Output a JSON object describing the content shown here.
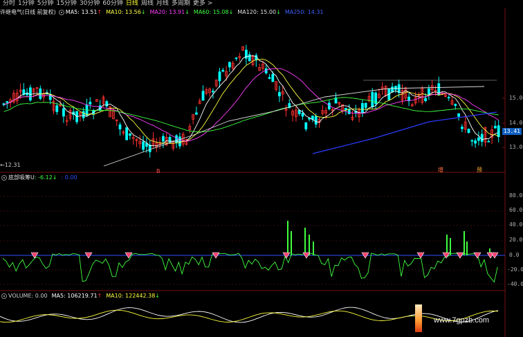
{
  "toolbar": {
    "items": [
      "分时",
      "1分钟",
      "5分钟",
      "15分钟",
      "30分钟",
      "60分钟",
      "日线",
      "周线",
      "月线",
      "多周期",
      "更多"
    ],
    "active_index": 6,
    "more_arrow": ">"
  },
  "main_pane": {
    "title": "许继电气(日线 前复权)",
    "ma": [
      {
        "label": "MA5: 13.51",
        "arrow": "↑",
        "color": "#ffffff"
      },
      {
        "label": "MA10: 13.56",
        "arrow": "↓",
        "color": "#ffff40"
      },
      {
        "label": "MA20: 13.91",
        "arrow": "↓",
        "color": "#ff40ff"
      },
      {
        "label": "MA60: 15.08",
        "arrow": "↓",
        "color": "#40ff40"
      },
      {
        "label": "MA120: 15.00",
        "arrow": "↓",
        "color": "#e0e0e0"
      },
      {
        "label": "MA250: 14.31",
        "arrow": "",
        "color": "#4060ff"
      }
    ],
    "axis": [
      "15.0",
      "14.0",
      "13.0"
    ],
    "last_price": "13.41",
    "min_label": "12.31",
    "signals": [
      "B",
      "增",
      "预"
    ]
  },
  "indicator_pane": {
    "title": "底部吸筹U",
    "values": [
      {
        "label": ": -6.12",
        "arrow": "↓",
        "color": "#40ff40"
      },
      {
        "label": ": 0.00",
        "arrow": "",
        "color": "#3050ff"
      }
    ],
    "axis": [
      "80.0",
      "60.0",
      "40.0",
      "20.0",
      "0.0",
      "-20.0",
      "-40.0"
    ]
  },
  "volume_pane": {
    "values": [
      {
        "label": "VOLUME: 0.00",
        "arrow": "",
        "color": "#cfcfcf"
      },
      {
        "label": "MA5: 106219.71",
        "arrow": "↑",
        "color": "#ffffff"
      },
      {
        "label": "MA10: 122442.38",
        "arrow": "↓",
        "color": "#ffff40"
      }
    ]
  },
  "watermark": "www.7gpzb.com",
  "colors": {
    "up": "#ff3030",
    "down": "#00ffff",
    "ma5": "#ffffff",
    "ma10": "#ffff40",
    "ma20": "#ff40ff",
    "ma60": "#40ff40",
    "ma120": "#e0e0e0",
    "ma250": "#2a3cff",
    "indicator": "#40ff40",
    "zero_line": "#3050ff"
  }
}
